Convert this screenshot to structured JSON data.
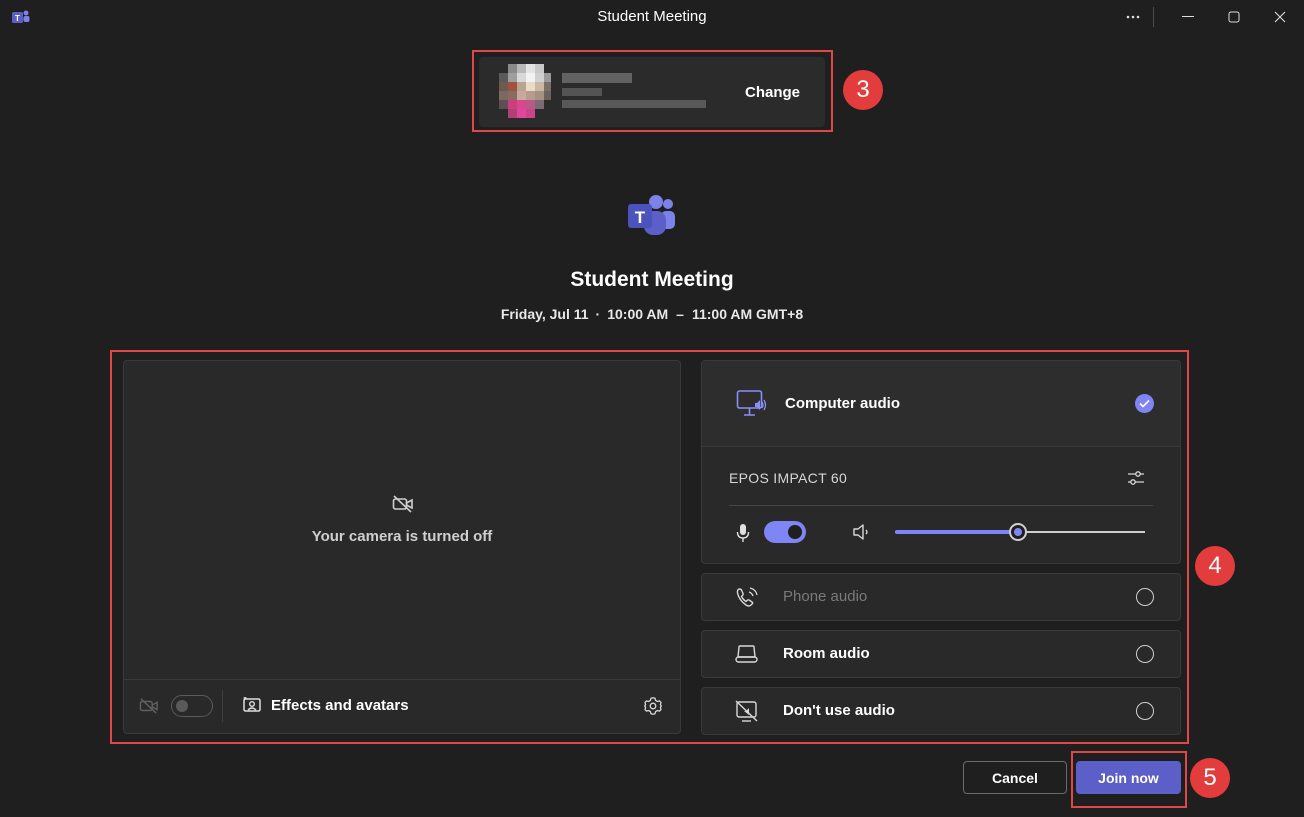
{
  "window": {
    "title": "Student Meeting",
    "controls": {
      "more": "more-options",
      "minimize": "minimize",
      "maximize": "maximize",
      "close": "close"
    }
  },
  "account": {
    "change_label": "Change"
  },
  "meeting": {
    "title": "Student Meeting",
    "date": "Friday, Jul 11",
    "start": "10:00 AM",
    "end": "11:00 AM GMT+8",
    "separator_dot": "·",
    "separator_dash": "–"
  },
  "video": {
    "camera_off_text": "Your camera is turned off",
    "camera_enabled": false,
    "effects_label": "Effects and avatars"
  },
  "audio": {
    "computer_audio": {
      "label": "Computer audio",
      "selected": true,
      "device": "EPOS IMPACT 60",
      "mic_enabled": true,
      "volume": 0.49
    },
    "options": [
      {
        "label": "Phone audio",
        "enabled": false,
        "selected": false,
        "icon": "phone-audio-icon"
      },
      {
        "label": "Room audio",
        "enabled": true,
        "selected": false,
        "icon": "room-audio-icon"
      },
      {
        "label": "Don't use audio",
        "enabled": true,
        "selected": false,
        "icon": "no-audio-icon"
      }
    ]
  },
  "actions": {
    "cancel_label": "Cancel",
    "join_label": "Join now"
  },
  "annotations": [
    {
      "number": "3",
      "target": "account-picker"
    },
    {
      "number": "4",
      "target": "device-settings"
    },
    {
      "number": "5",
      "target": "join-now-button"
    }
  ],
  "colors": {
    "background": "#1f1f1f",
    "panel": "#292929",
    "accent": "#7f85f5",
    "primary_button": "#5b5fc7",
    "annotation": "#e33c3c"
  }
}
